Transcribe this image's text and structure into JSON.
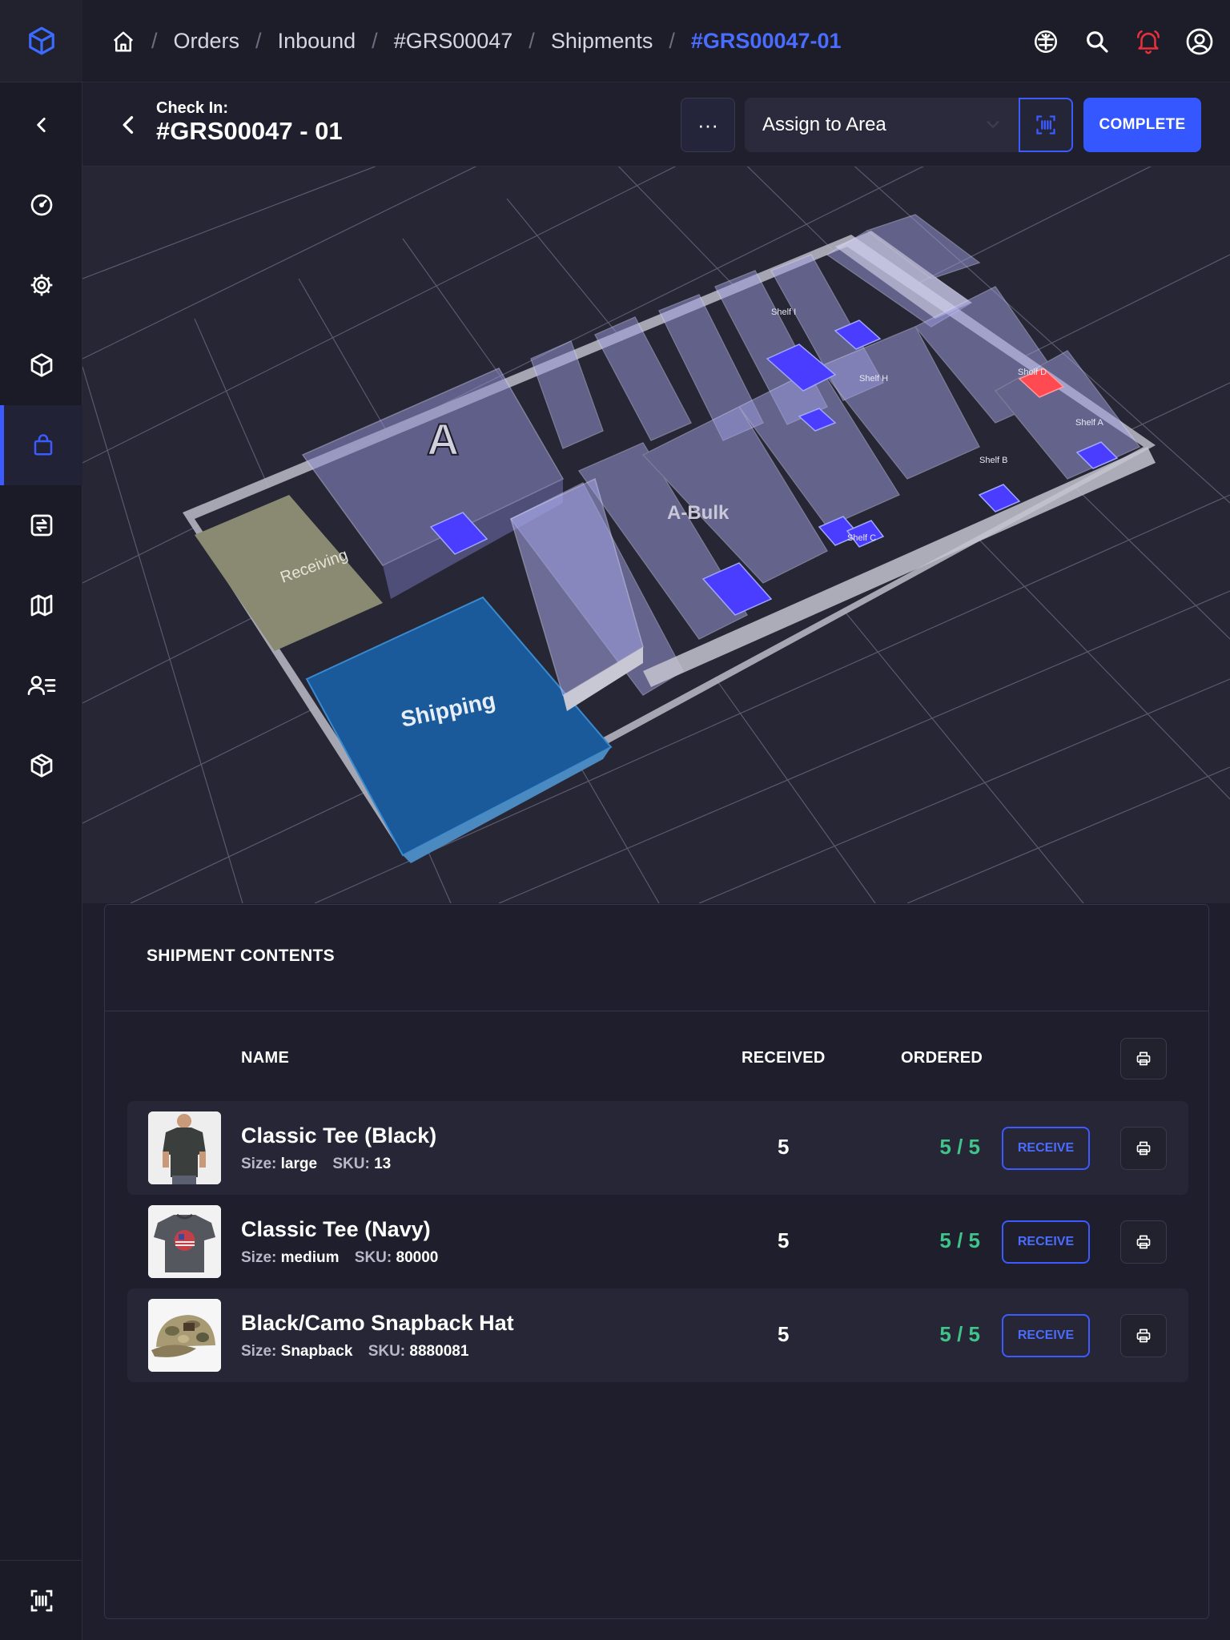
{
  "breadcrumb": {
    "items": [
      "Orders",
      "Inbound",
      "#GRS00047",
      "Shipments"
    ],
    "current": "#GRS00047-01"
  },
  "header": {
    "label": "Check In:",
    "title": "#GRS00047 - 01",
    "more_label": "···",
    "assign_placeholder": "Assign to Area",
    "complete_label": "COMPLETE"
  },
  "map": {
    "labels": {
      "zone_a": "A",
      "a_bulk": "A-Bulk",
      "receiving": "Receiving",
      "shipping": "Shipping",
      "shelf_i": "Shelf I",
      "shelf_h": "Shelf H",
      "shelf_d": "Shelf D",
      "shelf_a": "Shelf A",
      "shelf_b": "Shelf B",
      "shelf_c": "Shelf C"
    }
  },
  "contents": {
    "title": "SHIPMENT CONTENTS",
    "columns": {
      "name": "NAME",
      "received": "RECEIVED",
      "ordered": "ORDERED"
    },
    "receive_label": "RECEIVE",
    "size_key": "Size:",
    "sku_key": "SKU:",
    "rows": [
      {
        "name": "Classic Tee (Black)",
        "size": "large",
        "sku": "13",
        "received": "5",
        "ordered": "5 / 5",
        "thumb": "black-tee"
      },
      {
        "name": "Classic Tee (Navy)",
        "size": "medium",
        "sku": "80000",
        "received": "5",
        "ordered": "5 / 5",
        "thumb": "navy-tee"
      },
      {
        "name": "Black/Camo Snapback Hat",
        "size": "Snapback",
        "sku": "8880081",
        "received": "5",
        "ordered": "5 / 5",
        "thumb": "camo-hat"
      }
    ]
  },
  "colors": {
    "accent": "#3b5bff",
    "success": "#3fc48a",
    "alert": "#e8303c"
  }
}
